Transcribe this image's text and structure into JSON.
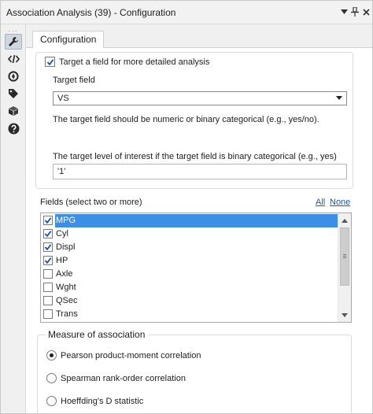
{
  "window": {
    "title": "Association Analysis (39) - Configuration",
    "buttons": [
      {
        "name": "pin-icon",
        "glyph": "▾"
      },
      {
        "name": "pushpin-icon",
        "glyph": "⊥"
      },
      {
        "name": "close-icon",
        "glyph": "✕"
      }
    ]
  },
  "sidebar": {
    "grip": "···",
    "icons": [
      "wrench-icon",
      "code-icon",
      "compass-icon",
      "tag-icon",
      "package-icon",
      "help-icon"
    ]
  },
  "tabs": [
    {
      "label": "Configuration",
      "active": true
    }
  ],
  "target": {
    "checkbox_label": "Target a field for more detailed analysis",
    "checked": true,
    "field_label": "Target field",
    "field_value": "VS",
    "note": "The target field should be numeric or binary categorical (e.g., yes/no).",
    "level_label": "The target level of interest if the target field is binary categorical (e.g., yes)",
    "level_value": "'1'"
  },
  "fields": {
    "label": "Fields (select two or more)",
    "all_link": "All",
    "none_link": "None",
    "items": [
      {
        "name": "MPG",
        "checked": true,
        "selected": true
      },
      {
        "name": "Cyl",
        "checked": true,
        "selected": false
      },
      {
        "name": "Displ",
        "checked": true,
        "selected": false
      },
      {
        "name": "HP",
        "checked": true,
        "selected": false
      },
      {
        "name": "Axle",
        "checked": false,
        "selected": false
      },
      {
        "name": "Wght",
        "checked": false,
        "selected": false
      },
      {
        "name": "QSec",
        "checked": false,
        "selected": false
      },
      {
        "name": "Trans",
        "checked": false,
        "selected": false
      }
    ]
  },
  "measure": {
    "label": "Measure of association",
    "options": [
      {
        "label": "Pearson product-moment correlation",
        "selected": true
      },
      {
        "label": "Spearman rank-order correlation",
        "selected": false
      },
      {
        "label": "Hoeffding's D statistic",
        "selected": false
      }
    ]
  },
  "colors": {
    "selection": "#3c8ee6",
    "link": "#1a55c5",
    "check": "#1a4fb5"
  }
}
